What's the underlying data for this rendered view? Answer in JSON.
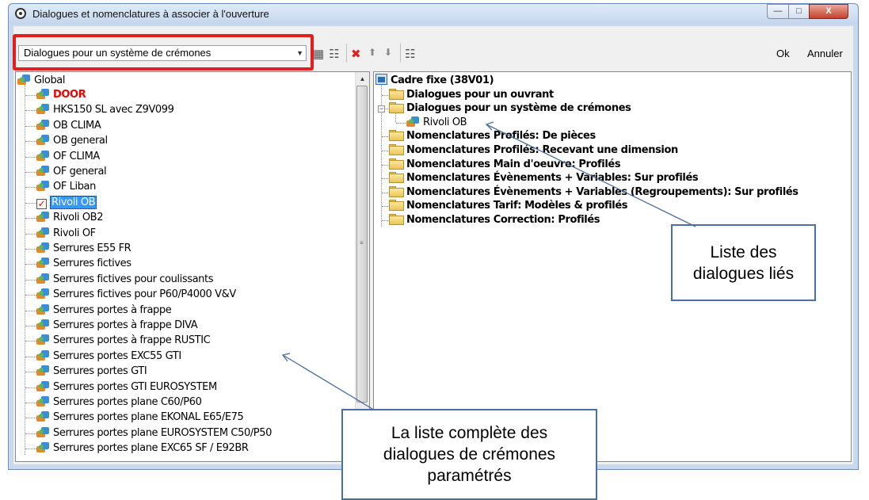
{
  "window": {
    "title": "Dialogues et nomenclatures à associer à l'ouverture",
    "minimize": "—",
    "maximize": "□",
    "close": "X"
  },
  "toolbar": {
    "combo_value": "Dialogues pour un système de crémones",
    "ok_label": "Ok",
    "cancel_label": "Annuler",
    "icons": [
      "tree-add-icon",
      "tree-expand-icon",
      "delete-icon",
      "move-up-icon",
      "move-down-icon",
      "tree-collapse-icon"
    ]
  },
  "left_tree": {
    "root": "Global",
    "items": [
      {
        "label": "DOOR",
        "style": "red"
      },
      {
        "label": "HKS150 SL avec Z9V099"
      },
      {
        "label": "OB CLIMA"
      },
      {
        "label": "OB general"
      },
      {
        "label": "OF CLIMA"
      },
      {
        "label": "OF general"
      },
      {
        "label": "OF Liban"
      },
      {
        "label": "Rivoli OB",
        "style": "checked"
      },
      {
        "label": "Rivoli OB2"
      },
      {
        "label": "Rivoli OF"
      },
      {
        "label": "Serrures E55 FR"
      },
      {
        "label": "Serrures fictives"
      },
      {
        "label": "Serrures fictives pour coulissants"
      },
      {
        "label": "Serrures fictives pour P60/P4000 V&V"
      },
      {
        "label": "Serrures portes à frappe"
      },
      {
        "label": "Serrures portes à frappe DIVA"
      },
      {
        "label": "Serrures portes à frappe RUSTIC"
      },
      {
        "label": "Serrures portes EXC55 GTI"
      },
      {
        "label": "Serrures portes GTI"
      },
      {
        "label": "Serrures portes GTI EUROSYSTEM"
      },
      {
        "label": "Serrures portes plane C60/P60"
      },
      {
        "label": "Serrures portes plane EKONAL E65/E75"
      },
      {
        "label": "Serrures portes plane EUROSYSTEM C50/P50"
      },
      {
        "label": "Serrures portes plane EXC65 SF / E92BR"
      }
    ]
  },
  "right_tree": {
    "root": "Cadre fixe (38V01)",
    "items": [
      {
        "label": "Dialogues pour un ouvrant"
      },
      {
        "label": "Dialogues pour un système de crémones",
        "expanded": true,
        "child": "Rivoli OB"
      },
      {
        "label": "Nomenclatures Profilés: De pièces"
      },
      {
        "label": "Nomenclatures Profilés: Recevant une dimension"
      },
      {
        "label": "Nomenclatures Main d'oeuvre: Profilés"
      },
      {
        "label": "Nomenclatures Évènements + Variables: Sur profilés"
      },
      {
        "label": "Nomenclatures Évènements + Variables (Regroupements): Sur profilés"
      },
      {
        "label": "Nomenclatures Tarif: Modèles & profilés"
      },
      {
        "label": "Nomenclatures Correction: Profilés"
      }
    ]
  },
  "callouts": {
    "linked": "Liste des dialogues liés",
    "full_list": "La liste complète des dialogues de crémones paramétrés"
  },
  "colors": {
    "highlight_box": "#e41e1e",
    "callout_border": "#4a6fa0",
    "selection": "#3399ff"
  }
}
